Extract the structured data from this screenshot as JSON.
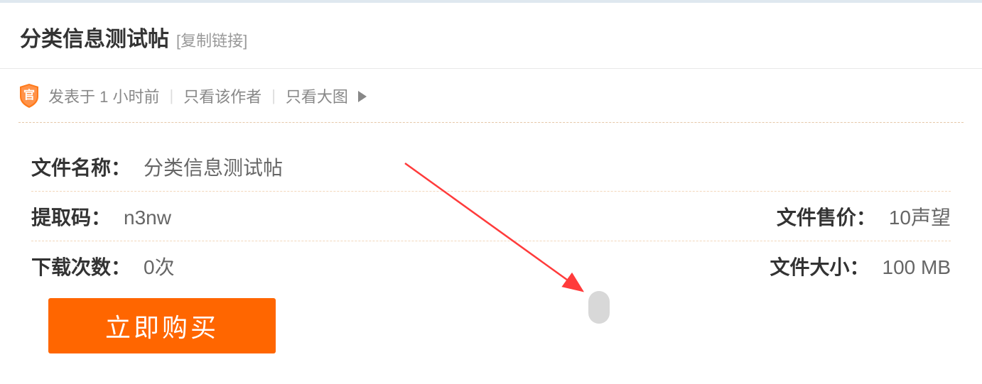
{
  "header": {
    "title": "分类信息测试帖",
    "copy_link": "[复制链接]"
  },
  "meta": {
    "posted_at": "发表于 1 小时前",
    "author_only": "只看该作者",
    "big_image": "只看大图"
  },
  "info": {
    "filename_label": "文件名称：",
    "filename_value": "分类信息测试帖",
    "code_label": "提取码：",
    "code_value": "n3nw",
    "price_label": "文件售价：",
    "price_value": "10声望",
    "downloads_label": "下载次数：",
    "downloads_value": "0次",
    "size_label": "文件大小：",
    "size_value": "100 MB"
  },
  "buttons": {
    "buy": "立即购买"
  }
}
